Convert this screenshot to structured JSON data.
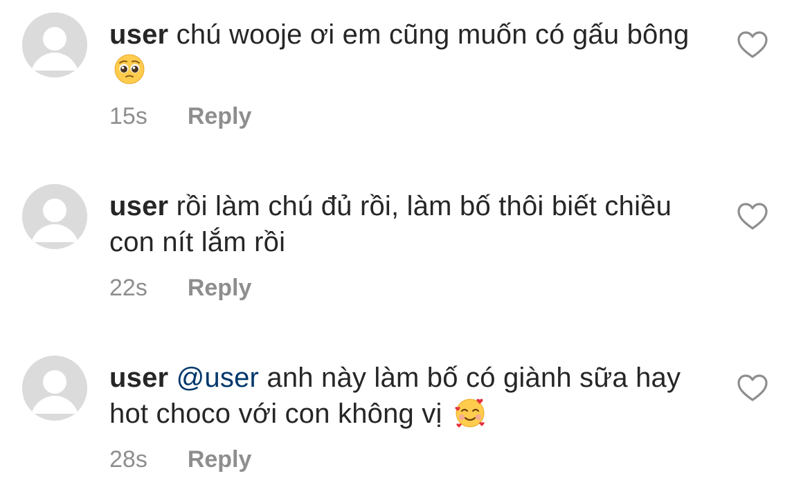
{
  "comments": [
    {
      "username": "user",
      "mention": "",
      "text": "chú wooje ơi em cũng muốn có gấu bông",
      "emoji": "pleading-face",
      "time": "15s",
      "reply_label": "Reply"
    },
    {
      "username": "user",
      "mention": "",
      "text": "rồi làm chú đủ rồi, làm bố thôi biết chiều con nít lắm rồi",
      "emoji": "",
      "time": "22s",
      "reply_label": "Reply"
    },
    {
      "username": "user",
      "mention": "@user",
      "text": "anh này làm bố có giành sữa hay hot choco với con không vị",
      "emoji": "smiling-face-with-hearts",
      "time": "28s",
      "reply_label": "Reply"
    }
  ],
  "colors": {
    "text": "#262626",
    "meta": "#8e8e8e",
    "mention": "#00376b",
    "avatar_bg": "#dbdbdb"
  },
  "icons": [
    "avatar-placeholder-icon",
    "heart-outline-icon"
  ]
}
